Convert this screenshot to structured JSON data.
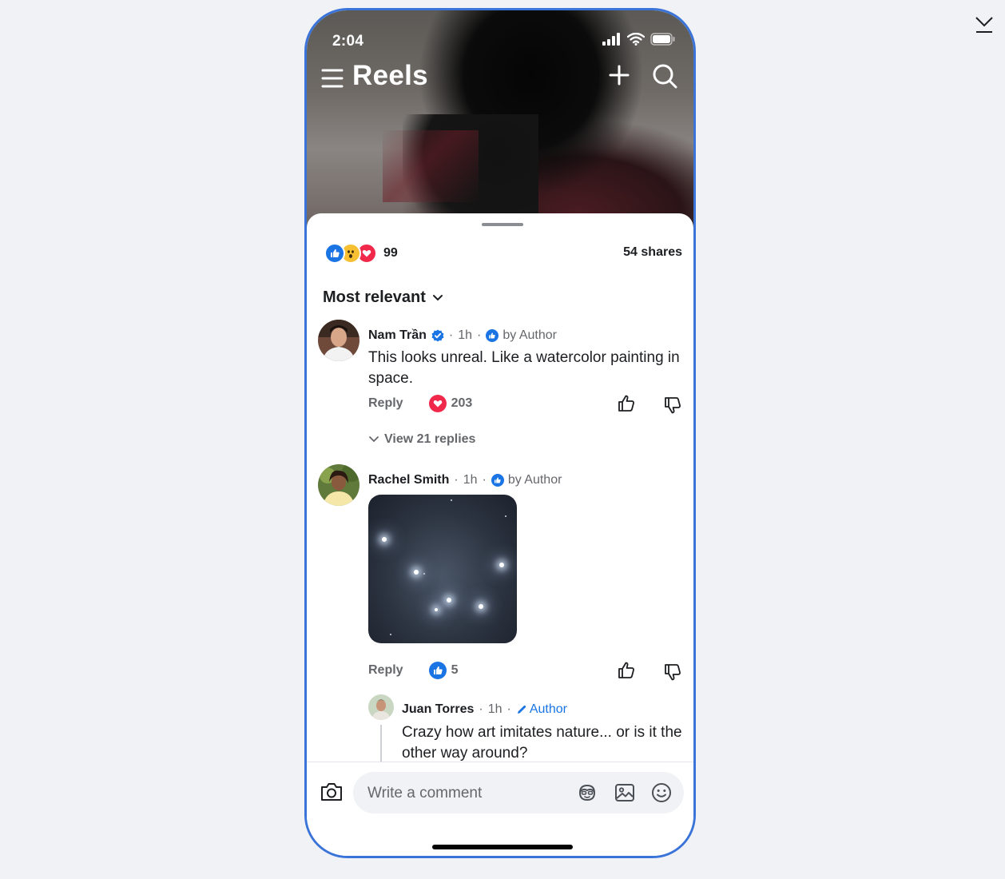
{
  "status_bar": {
    "time": "2:04"
  },
  "header": {
    "title": "Reels"
  },
  "summary": {
    "reaction_count": "99",
    "shares": "54 shares"
  },
  "sort": {
    "label": "Most relevant"
  },
  "comments": [
    {
      "name": "Nam Trần",
      "verified": true,
      "time": "1h",
      "badge": "by Author",
      "text": "This looks unreal. Like a watercolor painting in space.",
      "reply_label": "Reply",
      "reaction": "love",
      "reaction_count": "203",
      "view_replies": "View 21 replies"
    },
    {
      "name": "Rachel Smith",
      "time": "1h",
      "badge": "by Author",
      "reply_label": "Reply",
      "reaction": "like",
      "reaction_count": "5"
    }
  ],
  "reply": {
    "name": "Juan Torres",
    "time": "1h",
    "badge": "Author",
    "text": "Crazy how art imitates nature... or is it the other way around?"
  },
  "composer": {
    "placeholder": "Write a comment"
  },
  "colors": {
    "accent": "#1b74e4",
    "phone_border": "#3b74d9",
    "love": "#f0284a"
  }
}
